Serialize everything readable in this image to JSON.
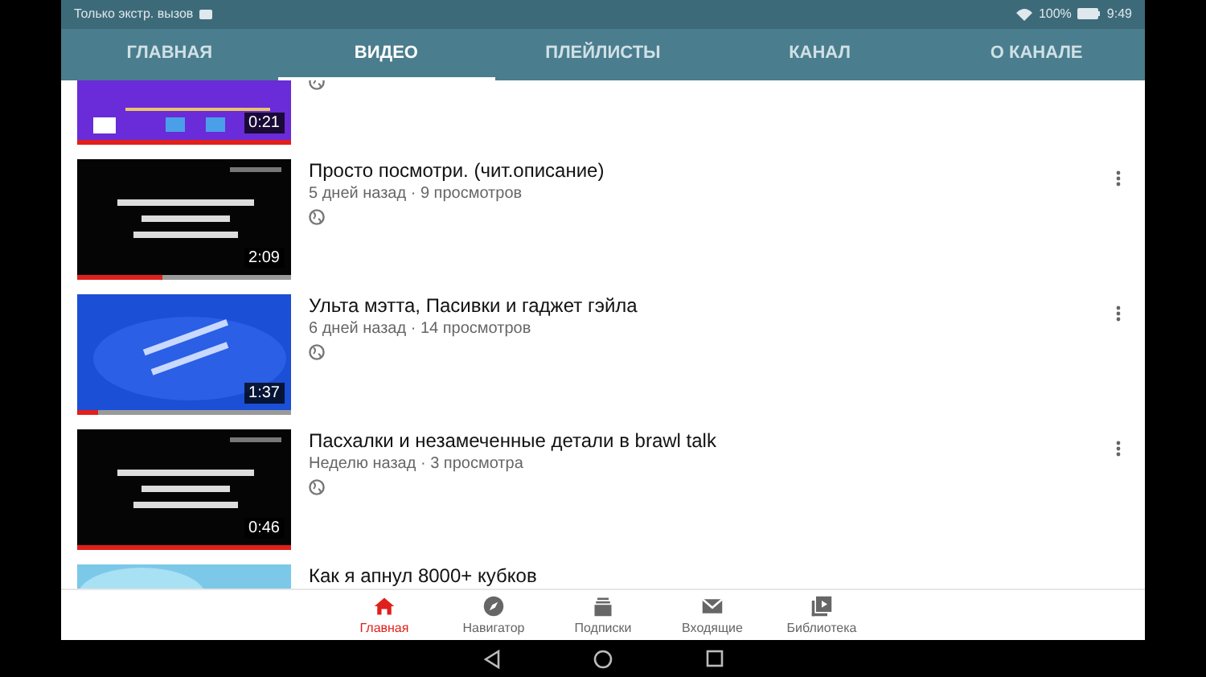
{
  "status_bar": {
    "carrier": "Только экстр. вызов",
    "battery": "100%",
    "time": "9:49"
  },
  "tabs": [
    {
      "label": "ГЛАВНАЯ",
      "selected": false
    },
    {
      "label": "ВИДЕО",
      "selected": true
    },
    {
      "label": "ПЛЕЙЛИСТЫ",
      "selected": false
    },
    {
      "label": "КАНАЛ",
      "selected": false
    },
    {
      "label": "О КАНАЛЕ",
      "selected": false
    }
  ],
  "videos": [
    {
      "duration": "0:21",
      "level": 1
    },
    {
      "title": "Просто посмотри. (чит.описание)",
      "meta": "5 дней назад · 9 просмотров",
      "duration": "2:09",
      "level": 0.4
    },
    {
      "title": "Ульта мэтта, Пасивки и гаджет гэйла",
      "meta": "6 дней назад · 14 просмотров",
      "duration": "1:37",
      "level": 0.1
    },
    {
      "title": "Пасхалки и незамеченные детали в brawl talk",
      "meta": "Неделю назад · 3 просмотра",
      "duration": "0:46",
      "level": 1
    },
    {
      "title": "Как я апнул 8000+ кубков"
    }
  ],
  "bottom_nav": [
    {
      "label": "Главная",
      "selected": true
    },
    {
      "label": "Навигатор",
      "selected": false
    },
    {
      "label": "Подписки",
      "selected": false
    },
    {
      "label": "Входящие",
      "selected": false
    },
    {
      "label": "Библиотека",
      "selected": false
    }
  ]
}
